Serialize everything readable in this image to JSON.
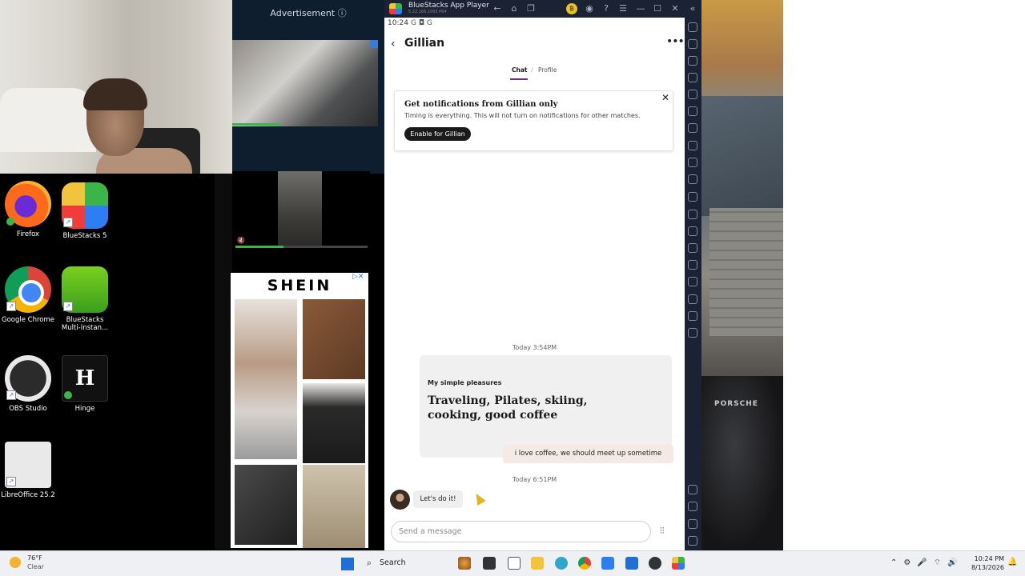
{
  "desktop": {
    "ad_label": "Advertisement ⓘ",
    "shein_logo": "SHEIN",
    "icons": [
      {
        "label": "Firefox"
      },
      {
        "label": "BlueStacks 5"
      },
      {
        "label": "Google Chrome"
      },
      {
        "label": "BlueStacks Multi-Instan..."
      },
      {
        "label": "OBS Studio"
      },
      {
        "label": "Hinge"
      },
      {
        "label": "LibreOffice 25.2"
      }
    ],
    "hinge_glyph": "H"
  },
  "bluestacks": {
    "title": "BlueStacks App Player",
    "version": "5.22.166.1003 P64",
    "coin": "₿"
  },
  "phone": {
    "time": "10:24",
    "status_icons": "G ◘ G",
    "contact_name": "Gillian",
    "more_glyph": "•••",
    "tabs": {
      "chat": "Chat",
      "profile": "Profile"
    },
    "notification": {
      "title": "Get notifications from Gillian only",
      "body": "Timing is everything. This will not turn on notifications for other matches.",
      "button": "Enable for Gillian"
    },
    "timestamp1": "Today 3:54PM",
    "prompt": {
      "question": "My simple pleasures",
      "answer": "Traveling, Pilates, skiing, cooking, good coffee"
    },
    "my_reply": "i love coffee, we should meet up sometime",
    "timestamp2": "Today 6:51PM",
    "their_message": "Let's do it!",
    "input_placeholder": "Send a message"
  },
  "taskbar": {
    "weather_temp": "76°F",
    "weather_cond": "Clear",
    "search_label": "Search",
    "clock_time": "10:24 PM",
    "clock_date": "8/13/2026"
  },
  "colors": {
    "accent": "#6b2b7e",
    "bluestacks_frame": "#1a2233"
  }
}
